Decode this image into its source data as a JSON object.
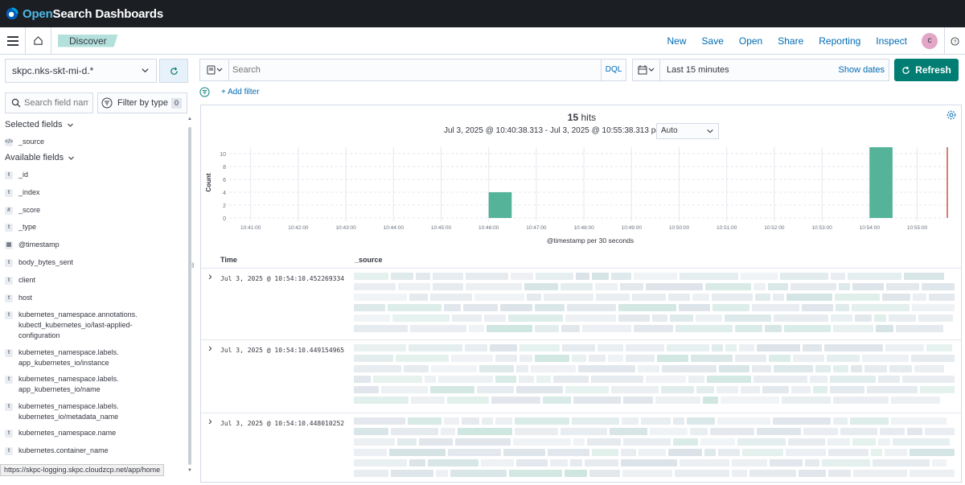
{
  "app": {
    "brand_prefix": "Open",
    "brand_suffix": "Search Dashboards"
  },
  "breadcrumb": {
    "label": "Discover"
  },
  "topnav": {
    "items": [
      "New",
      "Save",
      "Open",
      "Share",
      "Reporting",
      "Inspect"
    ]
  },
  "user": {
    "avatar_letter": "c"
  },
  "sidebar": {
    "index_pattern": "skpc.nks-skt-mi-d.*",
    "search_placeholder": "Search field nam",
    "filter_type_label": "Filter by type",
    "filter_type_count": "0",
    "selected_fields_label": "Selected fields",
    "available_fields_label": "Available fields",
    "selected_fields": [
      {
        "type": "source",
        "name": "_source"
      }
    ],
    "available_fields": [
      {
        "type": "t",
        "name": "_id"
      },
      {
        "type": "t",
        "name": "_index"
      },
      {
        "type": "#",
        "name": "_score"
      },
      {
        "type": "t",
        "name": "_type"
      },
      {
        "type": "date",
        "name": "@timestamp"
      },
      {
        "type": "t",
        "name": "body_bytes_sent"
      },
      {
        "type": "t",
        "name": "client"
      },
      {
        "type": "t",
        "name": "host"
      },
      {
        "type": "t",
        "name": "kubernetes_namespace.annotations.\nkubectl_kubernetes_io/last-applied-\nconfiguration"
      },
      {
        "type": "t",
        "name": "kubernetes_namespace.labels.\napp_kubernetes_io/instance"
      },
      {
        "type": "t",
        "name": "kubernetes_namespace.labels.\napp_kubernetes_io/name"
      },
      {
        "type": "t",
        "name": "kubernetes_namespace.labels.\nkubernetes_io/metadata_name"
      },
      {
        "type": "t",
        "name": "kubernetes_namespace.name"
      },
      {
        "type": "t",
        "name": "kubernetes.container_name"
      }
    ]
  },
  "query": {
    "placeholder": "Search",
    "language": "DQL"
  },
  "time": {
    "range": "Last 15 minutes",
    "show_dates": "Show dates",
    "refresh_label": "Refresh"
  },
  "filters": {
    "add_label": "+ Add filter"
  },
  "results": {
    "hits_count": "15",
    "hits_label": "hits",
    "interval_text": "Jul 3, 2025 @ 10:40:38.313 - Jul 3, 2025 @ 10:55:38.313 per",
    "interval_value": "Auto",
    "columns": [
      "Time",
      "_source"
    ],
    "rows": [
      {
        "time": "Jul 3, 2025 @ 10:54:10.452269334"
      },
      {
        "time": "Jul 3, 2025 @ 10:54:10.449154965"
      },
      {
        "time": "Jul 3, 2025 @ 10:54:10.448010252"
      }
    ]
  },
  "chart_data": {
    "type": "bar",
    "xlabel": "@timestamp per 30 seconds",
    "ylabel": "Count",
    "ylim": [
      0,
      11
    ],
    "yticks": [
      0,
      2,
      4,
      6,
      8,
      10
    ],
    "x_ticks": [
      "10:41:00",
      "10:42:00",
      "10:43:00",
      "10:44:00",
      "10:45:00",
      "10:46:00",
      "10:47:00",
      "10:48:00",
      "10:49:00",
      "10:50:00",
      "10:51:00",
      "10:52:00",
      "10:53:00",
      "10:54:00",
      "10:55:00"
    ],
    "bars": [
      {
        "x": "10:46:00",
        "value": 4
      },
      {
        "x": "10:54:00",
        "value": 11
      }
    ],
    "bar_color": "#54b399",
    "now_marker": "10:55:38",
    "grid": true
  },
  "status_url": "https://skpc-logging.skpc.cloudzcp.net/app/home"
}
